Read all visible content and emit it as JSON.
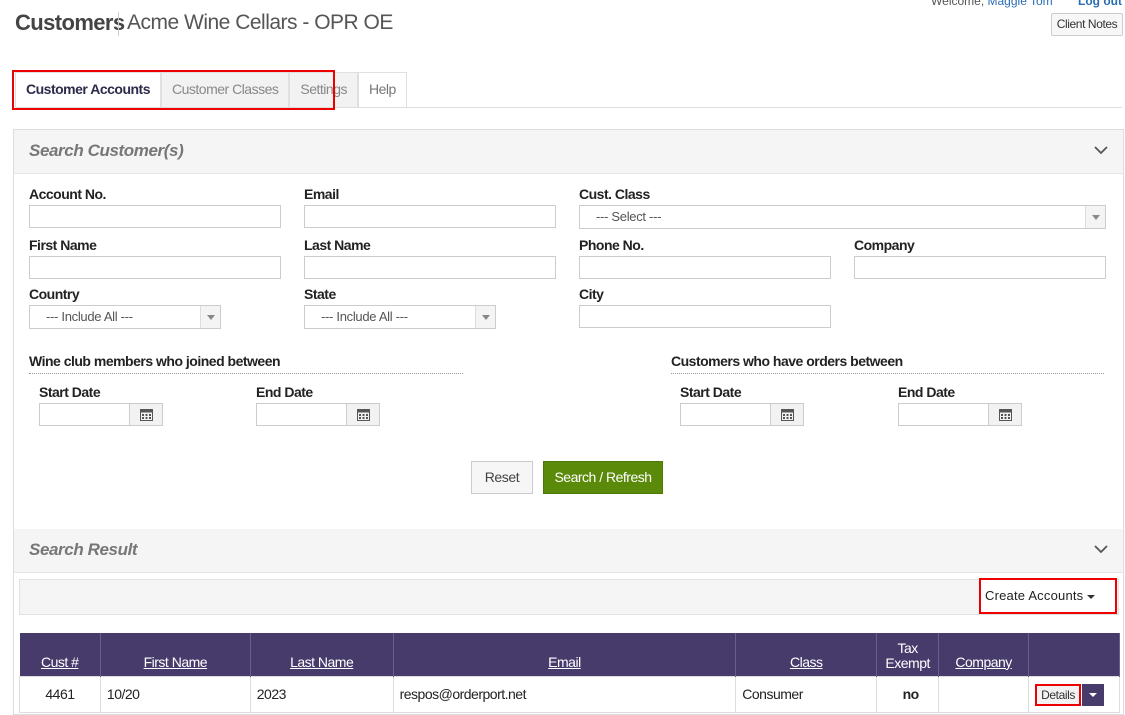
{
  "header": {
    "welcome_text": "Welcome,",
    "user_name": "Maggie Tom",
    "logout_label": "Log out",
    "title": "Customers",
    "subtitle": "Acme Wine Cellars - OPR OE",
    "client_notes_label": "Client Notes"
  },
  "tabs": [
    {
      "label": "Customer Accounts",
      "active": true
    },
    {
      "label": "Customer Classes",
      "active": false
    },
    {
      "label": "Settings",
      "active": false
    },
    {
      "label": "Help",
      "active": false
    }
  ],
  "search_panel": {
    "title": "Search Customer(s)",
    "fields": {
      "account_no": {
        "label": "Account No.",
        "value": ""
      },
      "email": {
        "label": "Email",
        "value": ""
      },
      "cust_class": {
        "label": "Cust. Class",
        "selected": "--- Select ---"
      },
      "first_name": {
        "label": "First Name",
        "value": ""
      },
      "last_name": {
        "label": "Last Name",
        "value": ""
      },
      "phone_no": {
        "label": "Phone No.",
        "value": ""
      },
      "company": {
        "label": "Company",
        "value": ""
      },
      "country": {
        "label": "Country",
        "selected": "--- Include All ---"
      },
      "state": {
        "label": "State",
        "selected": "--- Include All ---"
      },
      "city": {
        "label": "City",
        "value": ""
      }
    },
    "wine_club_group": {
      "title": "Wine club members who joined between",
      "start_label": "Start Date",
      "end_label": "End Date"
    },
    "orders_group": {
      "title": "Customers who have orders between",
      "start_label": "Start Date",
      "end_label": "End Date"
    },
    "reset_label": "Reset",
    "search_label": "Search / Refresh"
  },
  "results_panel": {
    "title": "Search Result",
    "create_accounts_label": "Create Accounts",
    "columns": {
      "cust_no": "Cust #",
      "first_name": "First Name",
      "last_name": "Last Name",
      "email": "Email",
      "class": "Class",
      "tax_line1": "Tax",
      "tax_line2": "Exempt",
      "company": "Company"
    },
    "rows": [
      {
        "cust_no": "4461",
        "first_name": "10/20",
        "last_name": "2023",
        "email": "respos@orderport.net",
        "class": "Consumer",
        "tax_exempt": "no",
        "company": "",
        "details_label": "Details"
      }
    ]
  },
  "colors": {
    "table_header": "#473b6b",
    "search_button": "#5b8a0a",
    "highlight": "#e00000"
  }
}
